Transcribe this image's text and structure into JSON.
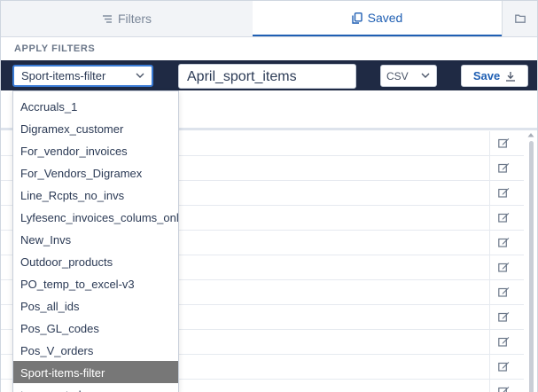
{
  "tabs": {
    "filters_label": "Filters",
    "saved_label": "Saved"
  },
  "section": {
    "title": "APPLY FILTERS"
  },
  "toolbar": {
    "selected_filter": "Sport-items-filter",
    "name_value": "April_sport_items",
    "format_value": "CSV",
    "save_label": "Save"
  },
  "dropdown": {
    "options": [
      "Accruals_1",
      "Digramex_customer",
      "For_vendor_invoices",
      "For_Vendors_Digramex",
      "Line_Rcpts_no_invs",
      "Lyfesenc_invoices_colums_only",
      "New_Invs",
      "Outdoor_products",
      "PO_temp_to_excel-v3",
      "Pos_all_ids",
      "Pos_GL_codes",
      "Pos_V_orders",
      "Sport-items-filter",
      "temp sorted vnam"
    ],
    "selected_index": 12
  },
  "colors": {
    "accent": "#1f5fb3",
    "toolbar_bg": "#1f2a44",
    "selected_option_bg": "#777777",
    "focus_border": "#3a7bd5"
  },
  "icons": {
    "filters_tab": "sliders-icon",
    "saved_tab": "copy-icon",
    "folder_tab": "folder-icon",
    "save_button": "download-icon",
    "row_action": "edit-icon",
    "select_arrow": "chevron-down-icon"
  }
}
